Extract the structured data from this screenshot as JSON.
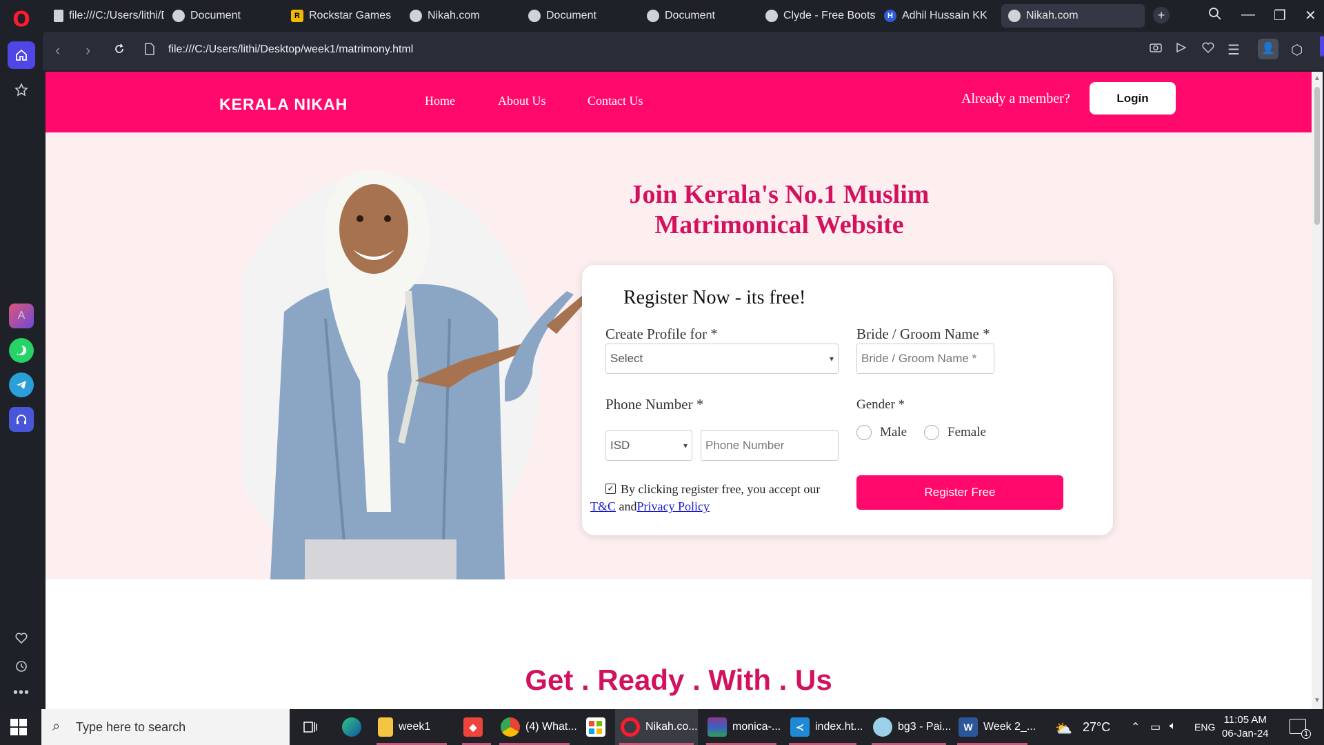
{
  "browser": {
    "tabs": [
      {
        "label": "file:///C:/Users/lithi/D"
      },
      {
        "label": "Document"
      },
      {
        "label": "Rockstar Games"
      },
      {
        "label": "Nikah.com"
      },
      {
        "label": "Document"
      },
      {
        "label": "Document"
      },
      {
        "label": "Clyde - Free Bootstra"
      },
      {
        "label": "Adhil Hussain KK"
      },
      {
        "label": "Nikah.com"
      }
    ],
    "url": "file:///C:/Users/lithi/Desktop/week1/matrimony.html"
  },
  "site": {
    "logo": "KERALA NIKAH",
    "nav": {
      "home": "Home",
      "about": "About Us",
      "contact": "Contact Us"
    },
    "member_text": "Already a member?",
    "login_label": "Login",
    "hero_title": "Join Kerala's No.1 Muslim Matrimonical Website",
    "form": {
      "title": "Register Now - its free!",
      "profile_label": "Create Profile for *",
      "profile_value": "Select",
      "name_label": "Bride / Groom Name *",
      "name_placeholder": "Bride / Groom Name *",
      "phone_label": "Phone Number *",
      "isd_value": "ISD",
      "phone_placeholder": "Phone Number",
      "gender_label": "Gender *",
      "male": "Male",
      "female": "Female",
      "terms_text": "By clicking register free, you accept our",
      "tc_link": "T&C",
      "and_text": "and",
      "privacy_link": "Privacy Policy",
      "register_label": "Register Free"
    },
    "section_title": "Get . Ready . With . Us"
  },
  "taskbar": {
    "search_placeholder": "Type here to search",
    "items": [
      {
        "label": "week1"
      },
      {
        "label": "(4) What..."
      },
      {
        "label": "Nikah.co..."
      },
      {
        "label": "monica-..."
      },
      {
        "label": "index.ht..."
      },
      {
        "label": "bg3 - Pai..."
      },
      {
        "label": "Week 2_..."
      }
    ],
    "weather": "27°C",
    "lang": "ENG",
    "time": "11:05 AM",
    "date": "06-Jan-24",
    "notification_count": "1"
  },
  "colors": {
    "brand": "#ff0a6c",
    "title": "#d2125f",
    "hero_bg": "#fdeef0"
  }
}
